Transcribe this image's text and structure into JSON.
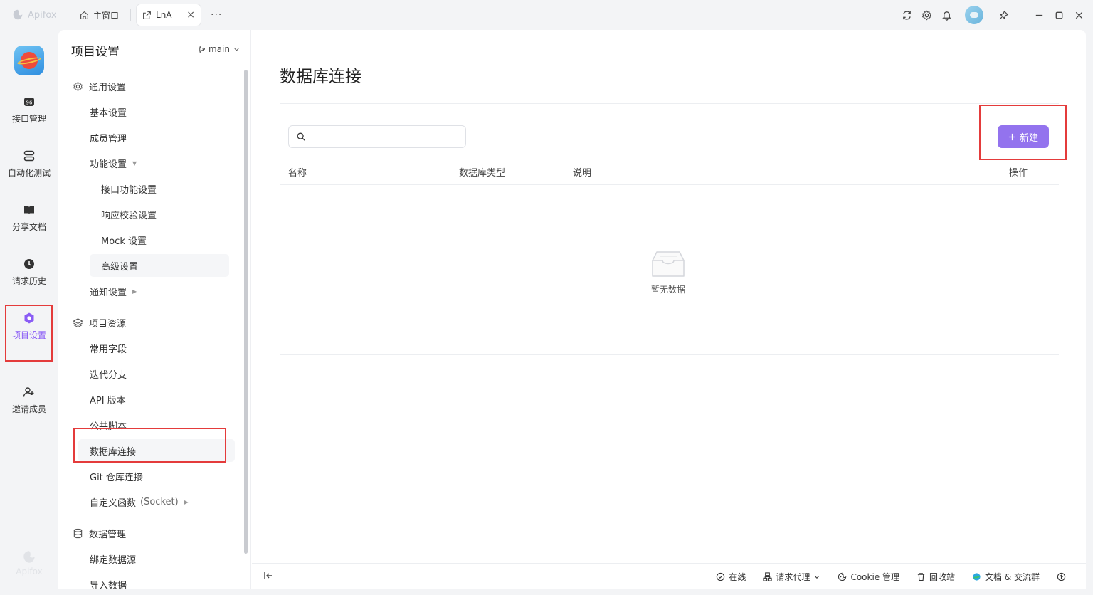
{
  "titlebar": {
    "brand": "Apifox",
    "home_tab": "主窗口",
    "active_tab": "LnA",
    "close_glyph": "×",
    "more_glyph": "···",
    "icons": [
      "refresh-icon",
      "settings-icon",
      "bell-icon",
      "avatar",
      "pin-icon",
      "minimize-icon",
      "maximize-icon",
      "close-icon"
    ]
  },
  "leftnav": {
    "items": [
      {
        "label": "接口管理",
        "icon": "api-icon"
      },
      {
        "label": "自动化测试",
        "icon": "automation-icon"
      },
      {
        "label": "分享文档",
        "icon": "book-icon"
      },
      {
        "label": "请求历史",
        "icon": "clock-icon"
      },
      {
        "label": "项目设置",
        "icon": "project-settings-icon",
        "active": true
      },
      {
        "label": "邀请成员",
        "icon": "invite-user-icon"
      }
    ],
    "footer": "Apifox"
  },
  "settings": {
    "title": "项目设置",
    "branch": "main",
    "groups": [
      {
        "label": "通用设置",
        "icon": "gear-icon"
      },
      {
        "label": "项目资源",
        "icon": "layers-icon"
      },
      {
        "label": "数据管理",
        "icon": "database-icon"
      }
    ],
    "items": {
      "basic": "基本设置",
      "members": "成员管理",
      "features": "功能设置",
      "api_features": "接口功能设置",
      "response_validation": "响应校验设置",
      "mock": "Mock 设置",
      "advanced": "高级设置",
      "notifications": "通知设置",
      "common_fields": "常用字段",
      "iteration_branch": "迭代分支",
      "api_version": "API 版本",
      "public_scripts": "公共脚本",
      "db_connection": "数据库连接",
      "git_connection": "Git 仓库连接",
      "custom_functions": "自定义函数",
      "custom_functions_sub": "(Socket)",
      "bind_datasource": "绑定数据源",
      "import_data": "导入数据"
    },
    "arrow_down": "▼",
    "arrow_right": "▶"
  },
  "main": {
    "title": "数据库连接",
    "search": {
      "placeholder": "",
      "value": ""
    },
    "new_button": "新建",
    "columns": [
      "名称",
      "数据库类型",
      "说明",
      "操作"
    ],
    "empty_text": "暂无数据"
  },
  "statusbar": {
    "online": "在线",
    "proxy": "请求代理",
    "cookie": "Cookie 管理",
    "recycle": "回收站",
    "docs": "文档 & 交流群"
  },
  "colors": {
    "accent": "#9373ee",
    "active_nav": "#8a5cf5",
    "annotation": "#e43b3b"
  }
}
